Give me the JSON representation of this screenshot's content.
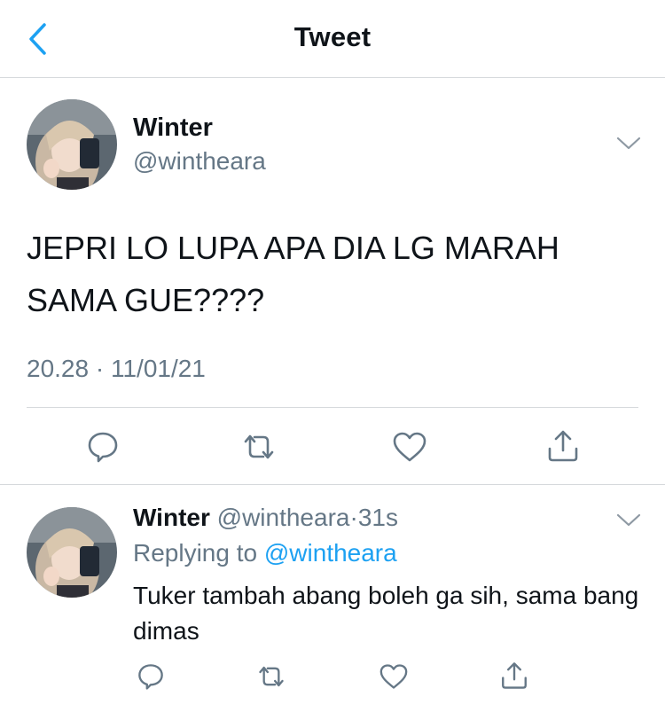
{
  "header": {
    "title": "Tweet"
  },
  "tweet": {
    "display_name": "Winter",
    "handle": "@wintheara",
    "text": "JEPRI LO LUPA APA DIA LG MARAH SAMA GUE????",
    "time": "20.28",
    "separator": "·",
    "date": "11/01/21"
  },
  "reply": {
    "display_name": "Winter",
    "handle": "@wintheara",
    "separator": "·",
    "age": "31s",
    "replying_prefix": "Replying to",
    "replying_mention": "@wintheara",
    "text": "Tuker tambah abang boleh ga sih, sama bang dimas"
  },
  "icons": {
    "back": "chevron-left-icon",
    "more": "chevron-down-icon",
    "reply": "comment-icon",
    "retweet": "retweet-icon",
    "like": "heart-icon",
    "share": "share-icon"
  },
  "colors": {
    "accent": "#1da1f2",
    "text": "#0f1419",
    "muted": "#657786",
    "divider": "#d6d9dc"
  }
}
